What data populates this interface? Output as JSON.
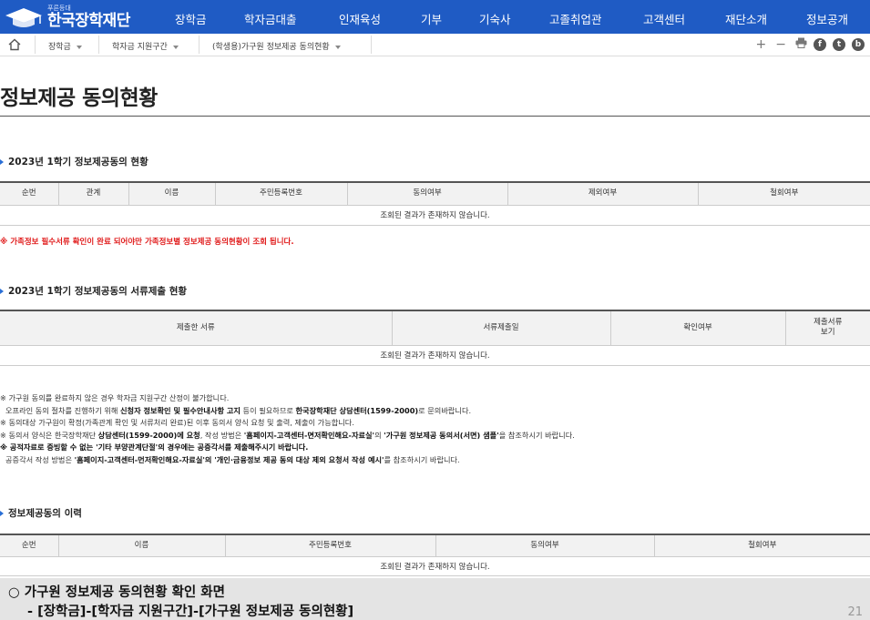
{
  "header": {
    "logo_small": "푸른등대",
    "logo_main": "한국장학재단",
    "nav": [
      "장학금",
      "학자금대출",
      "인재육성",
      "기부",
      "기숙사",
      "고졸취업관",
      "고객센터",
      "재단소개",
      "정보공개"
    ]
  },
  "breadcrumb": {
    "items": [
      "장학금",
      "학자금 지원구간",
      "(학생용)가구원 정보제공 동의현황"
    ]
  },
  "toolbar": {
    "zoom_in": "+",
    "zoom_out": "−",
    "print_icon": "print-icon",
    "social": [
      "f",
      "t",
      "b"
    ]
  },
  "page": {
    "title": "정보제공 동의현황"
  },
  "section1": {
    "title": "2023년 1학기 정보제공동의 현황",
    "headers": [
      "순번",
      "관계",
      "이름",
      "주민등록번호",
      "동의여부",
      "제외여부",
      "철회여부"
    ],
    "empty": "조회된 결과가 존재하지 않습니다.",
    "note": "※ 가족정보 필수서류 확인이 완료 되어야만 가족정보별 정보제공 동의현황이 조회 됩니다."
  },
  "section2": {
    "title": "2023년 1학기 정보제공동의 서류제출 현황",
    "headers": [
      "제출한 서류",
      "서류제출일",
      "확인여부",
      "제출서류\n보기"
    ],
    "header_last_line1": "제출서류",
    "header_last_line2": "보기",
    "empty": "조회된 결과가 존재하지 않습니다."
  },
  "notes": {
    "line1": "※ 가구원 동의를 완료하지 않은 경우 학자금 지원구간 산정이 불가합니다.",
    "line2a": "오프라인 동의 절차를 진행하기 위해 ",
    "line2b": "신청자 정보확인 및 필수안내사항 고지",
    "line2c": " 등이 필요하므로 ",
    "line2d": "한국장학재단 상담센터(1599-2000)",
    "line2e": "로 문의바랍니다.",
    "line3": "※ 동의대상 가구원이 확정(가족관계 확인 및 서류처리 완료)된 이후 동의서 양식 요청 및 출력, 제출이 가능합니다.",
    "line4a": "※ 동의서 양식은 한국장학재단 ",
    "line4b": "상담센터(1599-2000)에 요청",
    "line4c": ", 작성 방법은 ",
    "line4d": "'홈페이지-고객센터-면저확인해요-자료실'",
    "line4e": "의 ",
    "line4f": "'가구원 정보제공 동의서(서면) 샘플'",
    "line4g": "을 참조하시기 바랍니다.",
    "line5": "※ 공적자료로 증빙할 수 없는 '기타 부양관계단절'의 경우에는 공증각서를 제출해주시기 바랍니다.",
    "line6a": "공증각서 작성 방법은 ",
    "line6b": "'홈페이지-고객센터-먼저확인해요-자료실'의 '개인·금융정보 제공 동의 대상 제외 요청서 작성 예시'",
    "line6c": "를 참조하시기 바랍니다."
  },
  "section3": {
    "title": "정보제공동의 이력",
    "headers": [
      "순번",
      "이름",
      "주민등록번호",
      "동의여부",
      "철회여부"
    ],
    "empty": "조회된 결과가 존재하지 않습니다."
  },
  "caption": {
    "line1": "○ 가구원 정보제공 동의현황 확인 화면",
    "line2": "- [장학금]-[학자금 지원구간]-[가구원 정보제공 동의현황]",
    "page_number": "21"
  },
  "colors": {
    "nav_bg": "#1f5bc4",
    "warning": "#e01a1a",
    "accent_triangle": "#2a6fd6"
  }
}
